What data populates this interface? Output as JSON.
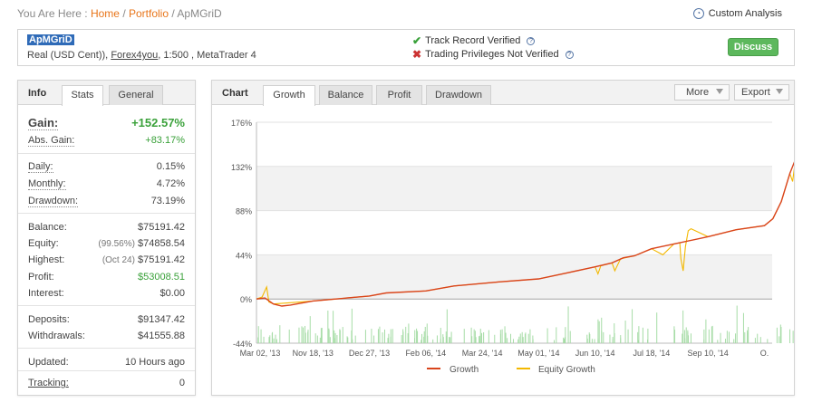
{
  "breadcrumb": {
    "prefix": "You Are Here :",
    "home": "Home",
    "sep": "/",
    "portfolio": "Portfolio",
    "current": "ApMGriD"
  },
  "custom_analysis": "Custom Analysis",
  "account": {
    "name": "ApMGriD",
    "type_prefix": "Real (USD Cent)),",
    "broker": "Forex4you",
    "details": ", 1:500 , MetaTrader 4",
    "track_record": "Track Record Verified",
    "trading_privileges": "Trading Privileges Not Verified",
    "discuss": "Discuss"
  },
  "info_panel": {
    "tabs": [
      "Info",
      "Stats",
      "General"
    ],
    "gain_label": "Gain:",
    "gain_value": "+152.57%",
    "abs_gain_label": "Abs. Gain:",
    "abs_gain_value": "+83.17%",
    "daily_label": "Daily:",
    "daily_value": "0.15%",
    "monthly_label": "Monthly:",
    "monthly_value": "4.72%",
    "drawdown_label": "Drawdown:",
    "drawdown_value": "73.19%",
    "balance_label": "Balance:",
    "balance_value": "$75191.42",
    "equity_label": "Equity:",
    "equity_pct": "(99.56%)",
    "equity_value": "$74858.54",
    "highest_label": "Highest:",
    "highest_date": "(Oct 24)",
    "highest_value": "$75191.42",
    "profit_label": "Profit:",
    "profit_value": "$53008.51",
    "interest_label": "Interest:",
    "interest_value": "$0.00",
    "deposits_label": "Deposits:",
    "deposits_value": "$91347.42",
    "withdrawals_label": "Withdrawals:",
    "withdrawals_value": "$41555.88",
    "updated_label": "Updated:",
    "updated_value": "10 Hours ago",
    "tracking_label": "Tracking:",
    "tracking_value": "0"
  },
  "chart_panel": {
    "title": "Chart",
    "tabs": [
      "Growth",
      "Balance",
      "Profit",
      "Drawdown"
    ],
    "more": "More",
    "export": "Export"
  },
  "colors": {
    "growth": "#d9441c",
    "equity": "#f3b800",
    "bars": "#a6dca6"
  },
  "chart_data": {
    "type": "line",
    "y_ticks": [
      "176%",
      "132%",
      "88%",
      "44%",
      "0%",
      "-44%"
    ],
    "ylim": [
      -44,
      176
    ],
    "x_ticks": [
      "Mar 02, '13",
      "Nov 18, '13",
      "Dec 27, '13",
      "Feb 06, '14",
      "Mar 24, '14",
      "May 01, '14",
      "Jun 10, '14",
      "Jul 18, '14",
      "Sep 10, '14",
      "O."
    ],
    "series": [
      {
        "name": "Growth",
        "points": [
          [
            0,
            0
          ],
          [
            0.15,
            1
          ],
          [
            0.3,
            -5
          ],
          [
            0.45,
            -7
          ],
          [
            0.6,
            -6
          ],
          [
            1,
            -2
          ],
          [
            1.6,
            1
          ],
          [
            2,
            3
          ],
          [
            2.3,
            6
          ],
          [
            3,
            8
          ],
          [
            3.5,
            13
          ],
          [
            4.3,
            17
          ],
          [
            5,
            20
          ],
          [
            5.5,
            26
          ],
          [
            6,
            32
          ],
          [
            6.3,
            36
          ],
          [
            6.5,
            41
          ],
          [
            6.7,
            43
          ],
          [
            7,
            50
          ],
          [
            7.5,
            56
          ],
          [
            8,
            62
          ],
          [
            8.5,
            69
          ],
          [
            9,
            73
          ],
          [
            9.15,
            80
          ],
          [
            9.3,
            97
          ],
          [
            9.45,
            125
          ],
          [
            9.55,
            139
          ],
          [
            9.64,
            153
          ]
        ]
      },
      {
        "name": "Equity Growth",
        "points": [
          [
            0,
            0
          ],
          [
            0.1,
            2
          ],
          [
            0.18,
            12
          ],
          [
            0.22,
            -3
          ],
          [
            0.3,
            -5
          ],
          [
            1,
            -2
          ],
          [
            1.6,
            1
          ],
          [
            2,
            3
          ],
          [
            2.3,
            6
          ],
          [
            3,
            8
          ],
          [
            3.5,
            13
          ],
          [
            4.3,
            17
          ],
          [
            5,
            20
          ],
          [
            5.5,
            26
          ],
          [
            6,
            32
          ],
          [
            6.05,
            25
          ],
          [
            6.1,
            33
          ],
          [
            6.3,
            36
          ],
          [
            6.35,
            28
          ],
          [
            6.45,
            40
          ],
          [
            6.7,
            43
          ],
          [
            7,
            50
          ],
          [
            7.2,
            44
          ],
          [
            7.4,
            55
          ],
          [
            7.5,
            56
          ],
          [
            7.52,
            40
          ],
          [
            7.56,
            28
          ],
          [
            7.6,
            52
          ],
          [
            7.65,
            68
          ],
          [
            7.7,
            70
          ],
          [
            8,
            62
          ],
          [
            8.5,
            69
          ],
          [
            9,
            73
          ],
          [
            9.15,
            80
          ],
          [
            9.3,
            97
          ],
          [
            9.45,
            125
          ],
          [
            9.5,
            117
          ],
          [
            9.55,
            139
          ],
          [
            9.64,
            153
          ]
        ]
      }
    ],
    "legend": [
      "Growth",
      "Equity Growth"
    ],
    "grid": true
  }
}
